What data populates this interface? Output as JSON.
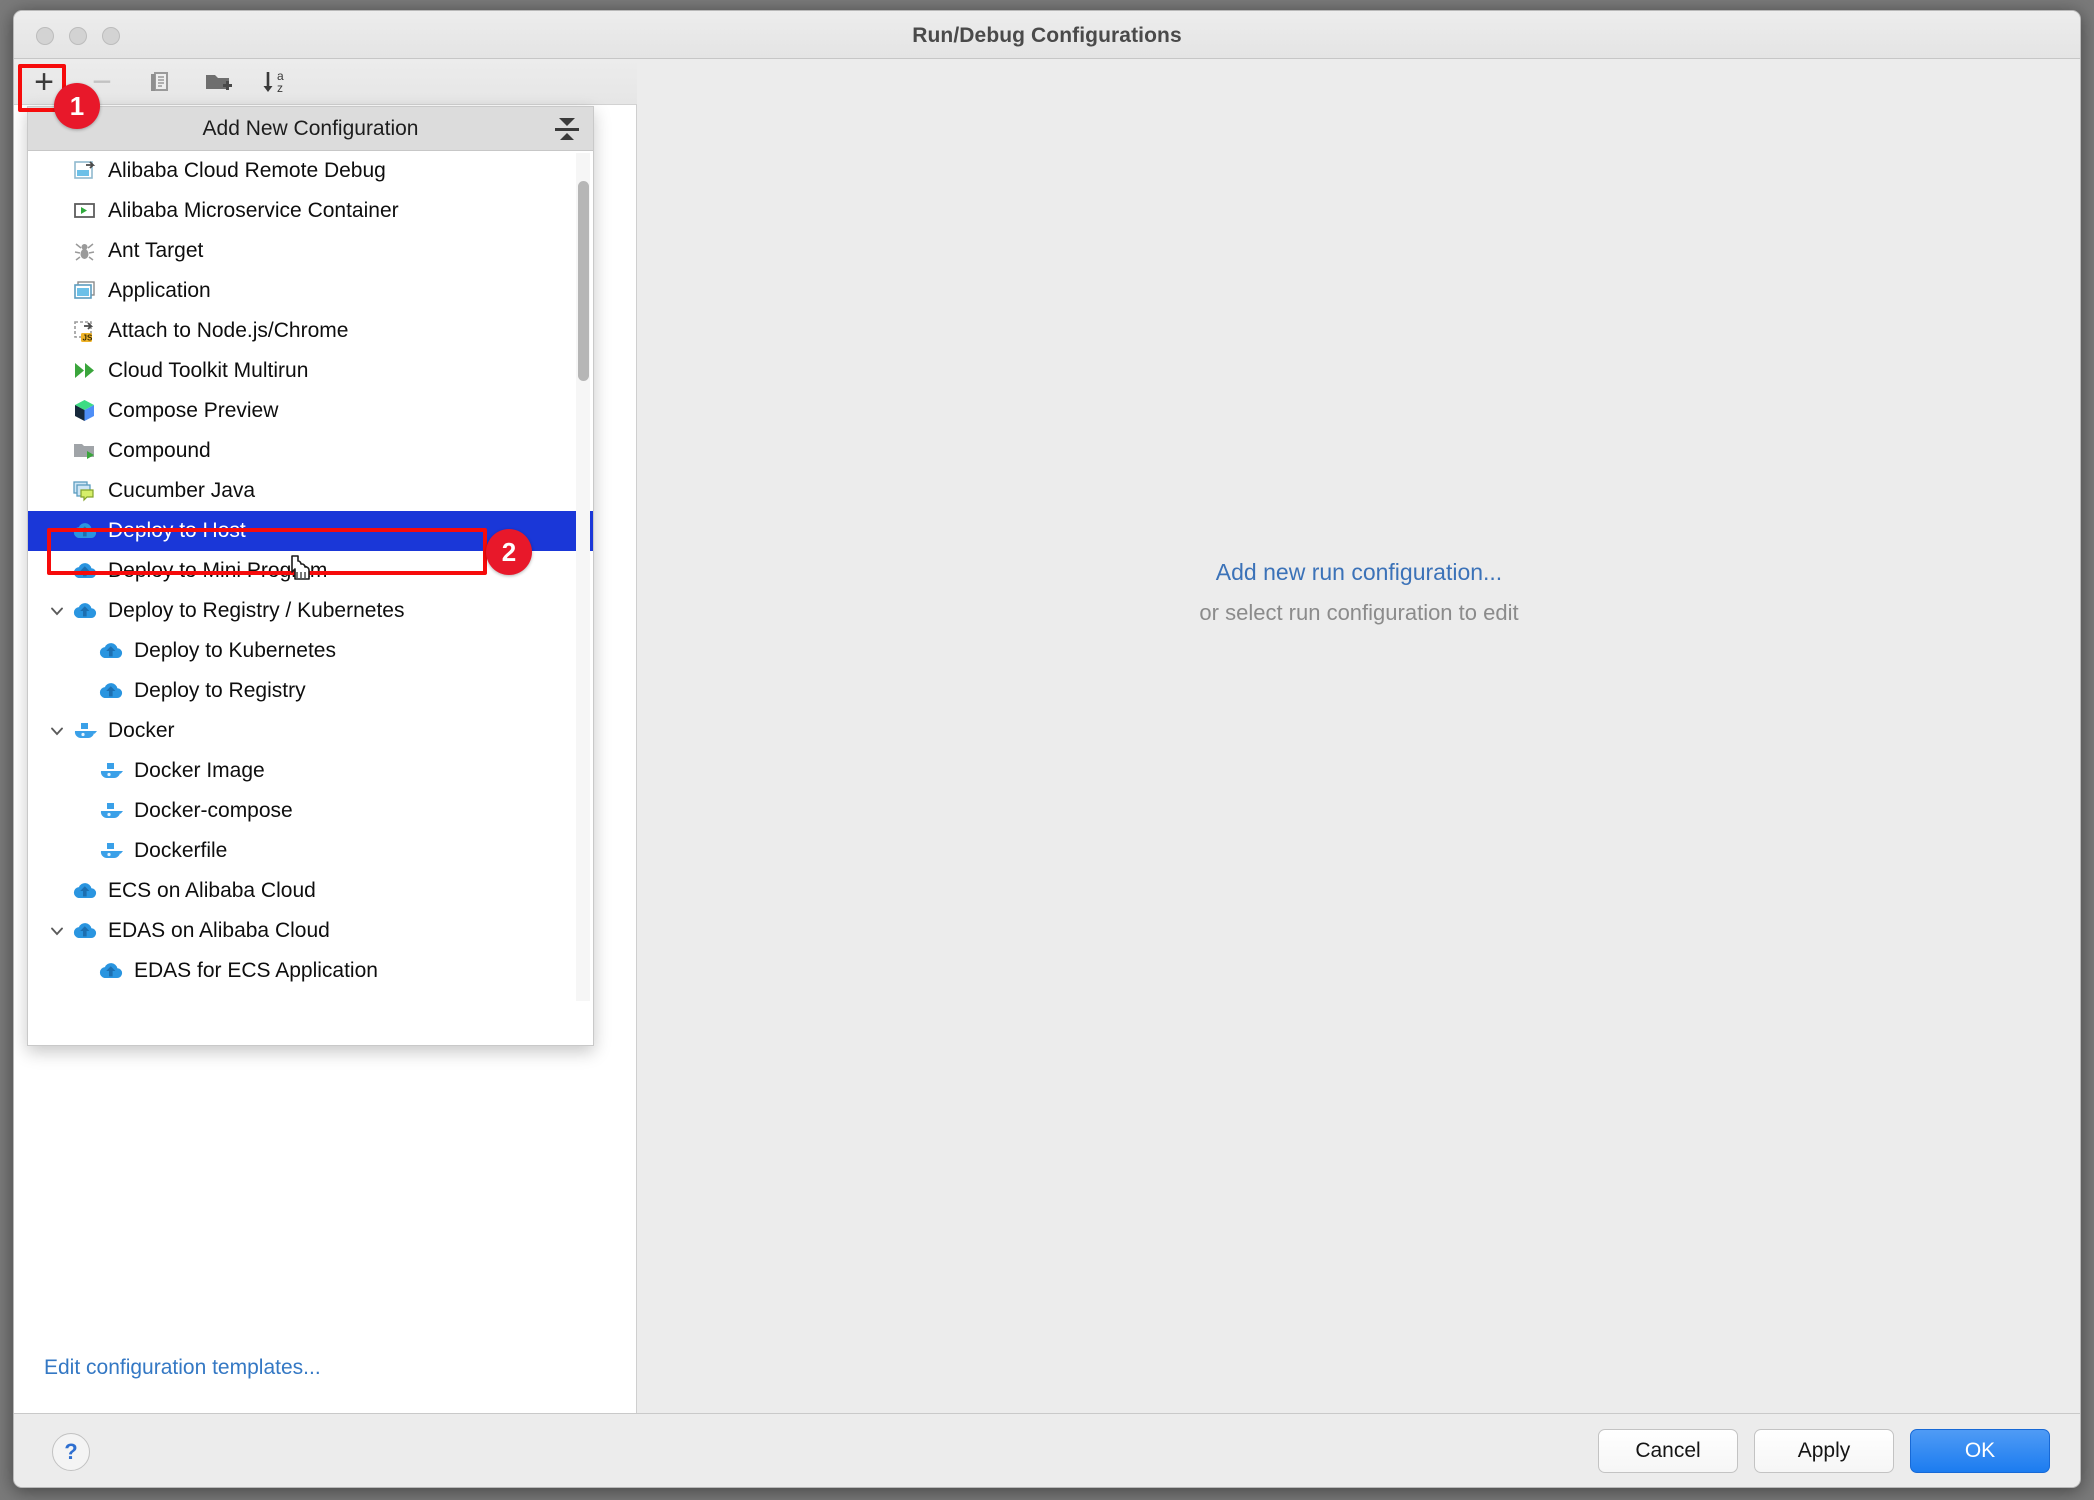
{
  "window": {
    "title": "Run/Debug Configurations"
  },
  "toolbar": {
    "add_label": "+",
    "remove_label": "−",
    "copy_icon": "copy-configuration-icon",
    "folder_icon": "new-folder-icon",
    "sort_icon": "sort-alphabetically-icon"
  },
  "popup": {
    "header": "Add New Configuration",
    "items": [
      {
        "label": "Alibaba Cloud Remote Debug",
        "icon": "alibaba-remote-debug-icon",
        "level": 0,
        "chevron": "",
        "selected": false
      },
      {
        "label": "Alibaba Microservice Container",
        "icon": "microservice-container-icon",
        "level": 0,
        "chevron": "",
        "selected": false
      },
      {
        "label": "Ant Target",
        "icon": "ant-icon",
        "level": 0,
        "chevron": "",
        "selected": false
      },
      {
        "label": "Application",
        "icon": "application-icon",
        "level": 0,
        "chevron": "",
        "selected": false
      },
      {
        "label": "Attach to Node.js/Chrome",
        "icon": "attach-nodejs-icon",
        "level": 0,
        "chevron": "",
        "selected": false
      },
      {
        "label": "Cloud Toolkit Multirun",
        "icon": "multirun-icon",
        "level": 0,
        "chevron": "",
        "selected": false
      },
      {
        "label": "Compose Preview",
        "icon": "compose-preview-icon",
        "level": 0,
        "chevron": "",
        "selected": false
      },
      {
        "label": "Compound",
        "icon": "compound-icon",
        "level": 0,
        "chevron": "",
        "selected": false
      },
      {
        "label": "Cucumber Java",
        "icon": "cucumber-java-icon",
        "level": 0,
        "chevron": "",
        "selected": false
      },
      {
        "label": "Deploy to Host",
        "icon": "cloud-deploy-icon",
        "level": 0,
        "chevron": "",
        "selected": true
      },
      {
        "label": "Deploy to Mini Program",
        "icon": "cloud-deploy-icon",
        "level": 0,
        "chevron": "",
        "selected": false
      },
      {
        "label": "Deploy to Registry / Kubernetes",
        "icon": "cloud-deploy-icon",
        "level": 0,
        "chevron": "v",
        "selected": false
      },
      {
        "label": "Deploy to Kubernetes",
        "icon": "cloud-deploy-icon",
        "level": 1,
        "chevron": "",
        "selected": false
      },
      {
        "label": "Deploy to Registry",
        "icon": "cloud-deploy-icon",
        "level": 1,
        "chevron": "",
        "selected": false
      },
      {
        "label": "Docker",
        "icon": "docker-icon",
        "level": 0,
        "chevron": "v",
        "selected": false
      },
      {
        "label": "Docker Image",
        "icon": "docker-icon",
        "level": 1,
        "chevron": "",
        "selected": false
      },
      {
        "label": "Docker-compose",
        "icon": "docker-icon",
        "level": 1,
        "chevron": "",
        "selected": false
      },
      {
        "label": "Dockerfile",
        "icon": "docker-icon",
        "level": 1,
        "chevron": "",
        "selected": false
      },
      {
        "label": "ECS on Alibaba Cloud",
        "icon": "cloud-deploy-icon",
        "level": 0,
        "chevron": "",
        "selected": false
      },
      {
        "label": "EDAS on Alibaba Cloud",
        "icon": "cloud-deploy-icon",
        "level": 0,
        "chevron": "v",
        "selected": false
      },
      {
        "label": "EDAS for ECS Application",
        "icon": "cloud-deploy-icon",
        "level": 1,
        "chevron": "",
        "selected": false
      }
    ]
  },
  "main": {
    "add_link": "Add new run configuration...",
    "subtitle": "or select run configuration to edit"
  },
  "left_pane": {
    "edit_templates": "Edit configuration templates..."
  },
  "footer": {
    "help": "?",
    "cancel": "Cancel",
    "apply": "Apply",
    "ok": "OK"
  },
  "annotations": {
    "badge1": "1",
    "badge2": "2"
  },
  "colors": {
    "selection_blue": "#1a37d8",
    "annotation_red": "#f60b0b",
    "badge_red": "#e8182a",
    "link_blue": "#3478c4",
    "primary_button": "#1c7cf0"
  }
}
